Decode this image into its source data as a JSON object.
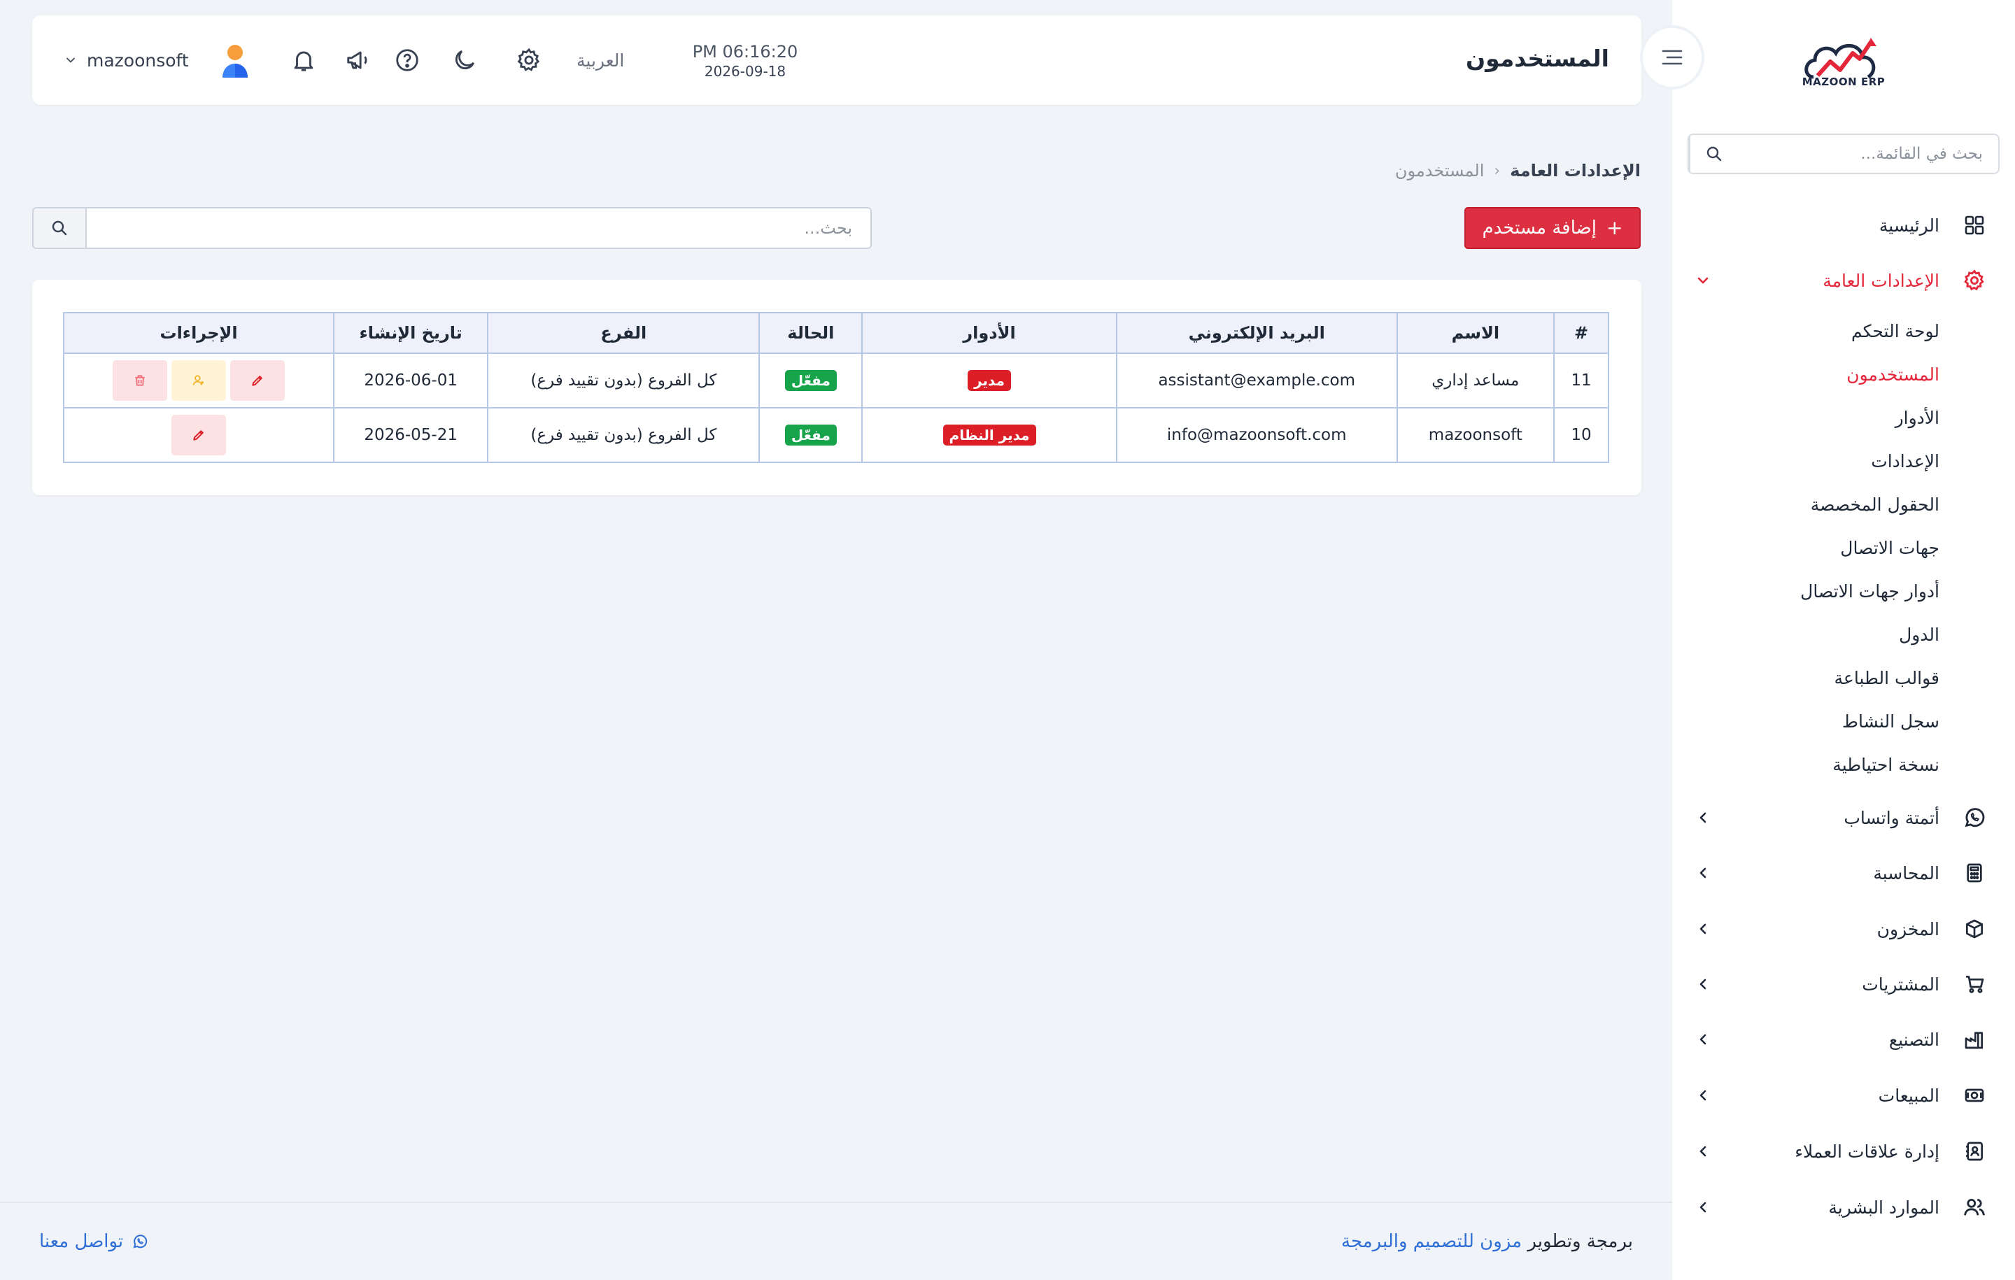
{
  "app": {
    "logo_text": "MAZOON ERP",
    "accent_color": "#dc2f42"
  },
  "sidebar": {
    "search_placeholder": "بحث في القائمة...",
    "items": [
      {
        "label": "الرئيسية",
        "icon": "grid-icon"
      },
      {
        "label": "الإعدادات العامة",
        "icon": "gear-icon",
        "active": true,
        "expanded": true
      },
      {
        "label": "أتمتة واتساب",
        "icon": "whatsapp-icon"
      },
      {
        "label": "المحاسبة",
        "icon": "calculator-icon"
      },
      {
        "label": "المخزون",
        "icon": "box-icon"
      },
      {
        "label": "المشتريات",
        "icon": "cart-icon"
      },
      {
        "label": "التصنيع",
        "icon": "factory-icon"
      },
      {
        "label": "المبيعات",
        "icon": "cash-icon"
      },
      {
        "label": "إدارة علاقات العملاء",
        "icon": "contacts-book-icon"
      },
      {
        "label": "الموارد البشرية",
        "icon": "users-icon"
      }
    ],
    "subitems": [
      {
        "label": "لوحة التحكم"
      },
      {
        "label": "المستخدمون",
        "active": true
      },
      {
        "label": "الأدوار"
      },
      {
        "label": "الإعدادات"
      },
      {
        "label": "الحقول المخصصة"
      },
      {
        "label": "جهات الاتصال"
      },
      {
        "label": "أدوار جهات الاتصال"
      },
      {
        "label": "الدول"
      },
      {
        "label": "قوالب الطباعة"
      },
      {
        "label": "سجل النشاط"
      },
      {
        "label": "نسخة احتياطية"
      }
    ]
  },
  "header": {
    "title": "المستخدمون",
    "time": "PM 06:16:20",
    "date": "2026-09-18",
    "language": "العربية",
    "username": "mazoonsoft"
  },
  "breadcrumb": {
    "parent": "الإعدادات العامة",
    "current": "المستخدمون"
  },
  "toolbar": {
    "add_label": "إضافة مستخدم",
    "search_placeholder": "بحث..."
  },
  "table": {
    "headers": [
      "#",
      "الاسم",
      "البريد الإلكتروني",
      "الأدوار",
      "الحالة",
      "الفرع",
      "تاريخ الإنشاء",
      "الإجراءات"
    ],
    "rows": [
      {
        "id": "11",
        "name": "مساعد إداري",
        "email": "assistant@example.com",
        "role": "مدير",
        "status": "مفعّل",
        "branch": "كل الفروع (بدون تقييد فرع)",
        "created": "2026-06-01"
      },
      {
        "id": "10",
        "name": "mazoonsoft",
        "email": "info@mazoonsoft.com",
        "role": "مدير النظام",
        "status": "مفعّل",
        "branch": "كل الفروع (بدون تقييد فرع)",
        "created": "2026-05-21"
      }
    ]
  },
  "footer": {
    "credit_prefix": "برمجة وتطوير",
    "credit_link": "مزون للتصميم والبرمجة",
    "contact": "تواصل معنا"
  }
}
